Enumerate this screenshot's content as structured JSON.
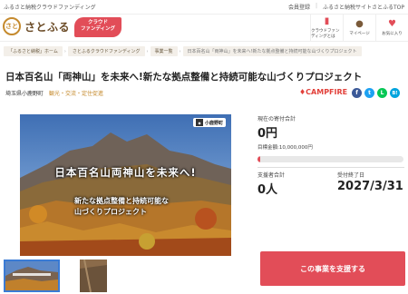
{
  "topbar": {
    "tagline": "ふるさと納税クラウドファンディング",
    "links": [
      "会員登録",
      "ふるさと納税サイトさとふるTOP"
    ]
  },
  "header": {
    "logo_mark": "さと",
    "logo_text": "さとふる",
    "badge_line1": "クラウド",
    "badge_line2": "ファンディング",
    "nav": [
      {
        "label": "クラウドファンディングとは",
        "icon": "book-icon"
      },
      {
        "label": "マイページ",
        "icon": "user-icon"
      },
      {
        "label": "お気に入り",
        "icon": "heart-icon"
      }
    ]
  },
  "breadcrumb": [
    "「ふるさと納税」ホーム",
    "さとふるクラウドファンディング",
    "事業一覧",
    "日本百名山「両神山」を未来へ!新たな拠点整備と持続可能な山づくりプロジェクト"
  ],
  "project": {
    "title": "日本百名山「両神山」を未来へ!新たな拠点整備と持続可能な山づくりプロジェクト",
    "organization": "埼玉県小鹿野町",
    "category": "観光・交流・定住促進",
    "platform": "CAMPFIRE",
    "share_icons": [
      "f",
      "t",
      "L",
      "B!"
    ]
  },
  "hero": {
    "title": "日本百名山両神山を未来へ!",
    "subtitle_line1": "新たな拠点整備と持続可能な",
    "subtitle_line2": "山づくりプロジェクト",
    "badge": "小鹿野町"
  },
  "stats": {
    "current_label": "現在の寄付合計",
    "current_value": "0円",
    "goal_label": "目標金額",
    "goal_value": "10,000,000円",
    "progress_fraction": 0,
    "supporters_label": "支援者合計",
    "supporters_value": "0人",
    "deadline_label": "受付終了日",
    "deadline_value": "2027/3/31"
  },
  "cta": {
    "label": "この事業を支援する"
  },
  "colors": {
    "accent": "#e24d58",
    "brand": "#c58a2d",
    "facebook": "#3b5998",
    "twitter": "#1da1f2",
    "line": "#06c755",
    "hatena": "#00a4de"
  }
}
